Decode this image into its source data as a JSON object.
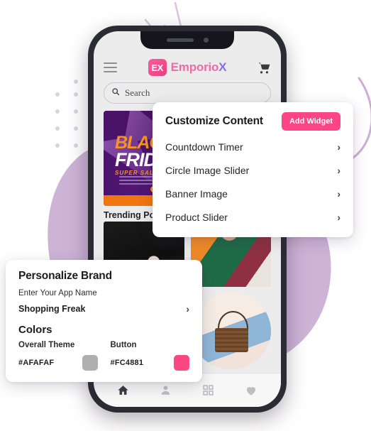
{
  "decor": {
    "blob_color": "#cdb3d6",
    "dot_color": "#e0cfe4",
    "line_color": "#d8bde0"
  },
  "phone": {
    "app": {
      "menu_icon": "hamburger-icon",
      "brand_mark": "EX",
      "brand_name": "Emporio",
      "brand_name_tail": "X",
      "cart_icon": "shopping-cart-icon",
      "search": {
        "icon": "search-icon",
        "placeholder": "Search",
        "value": "Search"
      },
      "banner": {
        "line1": "BLACK",
        "line2": "FRIDAY",
        "line3": "SUPER SALE"
      },
      "section_title": "Trending Po",
      "products": [
        {
          "name": "product-shoes",
          "favorite_icon": "heart-filled-icon",
          "favorite": true
        },
        {
          "name": "product-model",
          "favorite_icon": "heart-filled-icon",
          "favorite": true
        },
        {
          "name": "product-green-dress",
          "favorite_icon": "heart-icon",
          "favorite": false
        },
        {
          "name": "product-handbag",
          "favorite_icon": "heart-icon",
          "favorite": false
        }
      ],
      "bottom_nav": [
        {
          "name": "home",
          "icon": "home-icon",
          "active": true
        },
        {
          "name": "account",
          "icon": "person-icon",
          "active": false
        },
        {
          "name": "categories",
          "icon": "grid-icon",
          "active": false
        },
        {
          "name": "wishlist",
          "icon": "heart-icon",
          "active": false
        }
      ]
    }
  },
  "customize_panel": {
    "title": "Customize Content",
    "add_widget_label": "Add Widget",
    "add_widget_color": "#FB4584",
    "items": [
      {
        "label": "Countdown Timer",
        "chevron": "›"
      },
      {
        "label": "Circle Image Slider",
        "chevron": "›"
      },
      {
        "label": "Banner Image",
        "chevron": "›"
      },
      {
        "label": "Product Slider",
        "chevron": "›"
      }
    ]
  },
  "brand_panel": {
    "title": "Personalize Brand",
    "app_name_label": "Enter Your App Name",
    "app_name_value": "Shopping Freak",
    "app_name_chevron": "›",
    "colors_title": "Colors",
    "colors": [
      {
        "label": "Overall Theme",
        "hex": "#AFAFAF",
        "swatch": "#AFAFAF"
      },
      {
        "label": "Button",
        "hex": "#FC4881",
        "swatch": "#FC4881"
      }
    ]
  }
}
